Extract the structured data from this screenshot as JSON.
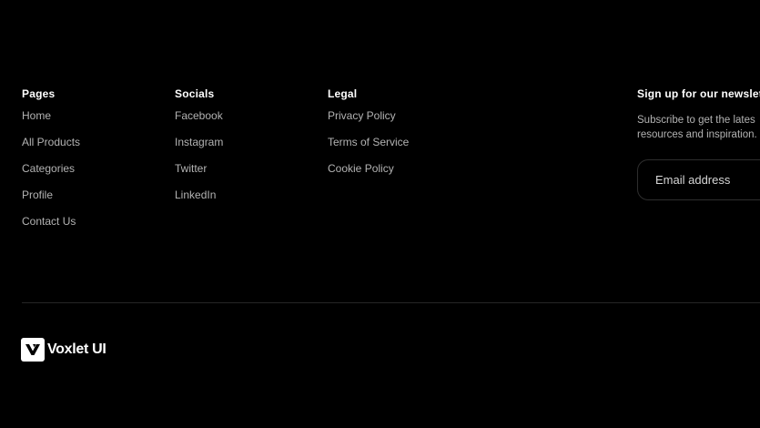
{
  "footer": {
    "pages": {
      "heading": "Pages",
      "items": [
        "Home",
        "All Products",
        "Categories",
        "Profile",
        "Contact Us"
      ]
    },
    "socials": {
      "heading": "Socials",
      "items": [
        "Facebook",
        "Instagram",
        "Twitter",
        "LinkedIn"
      ]
    },
    "legal": {
      "heading": "Legal",
      "items": [
        "Privacy Policy",
        "Terms of Service",
        "Cookie Policy"
      ]
    },
    "newsletter": {
      "heading": "Sign up for our newslet",
      "description_line1": "Subscribe to get the lates",
      "description_line2": "resources and inspiration.",
      "email_placeholder": "Email address"
    },
    "brand": {
      "name": "Voxlet UI",
      "logo_icon": "voxlet-logo-icon"
    }
  },
  "colors": {
    "background": "#000000",
    "heading": "#ffffff",
    "link": "#b3b3b3",
    "divider": "#262626",
    "input_border": "#2e2e2e"
  }
}
